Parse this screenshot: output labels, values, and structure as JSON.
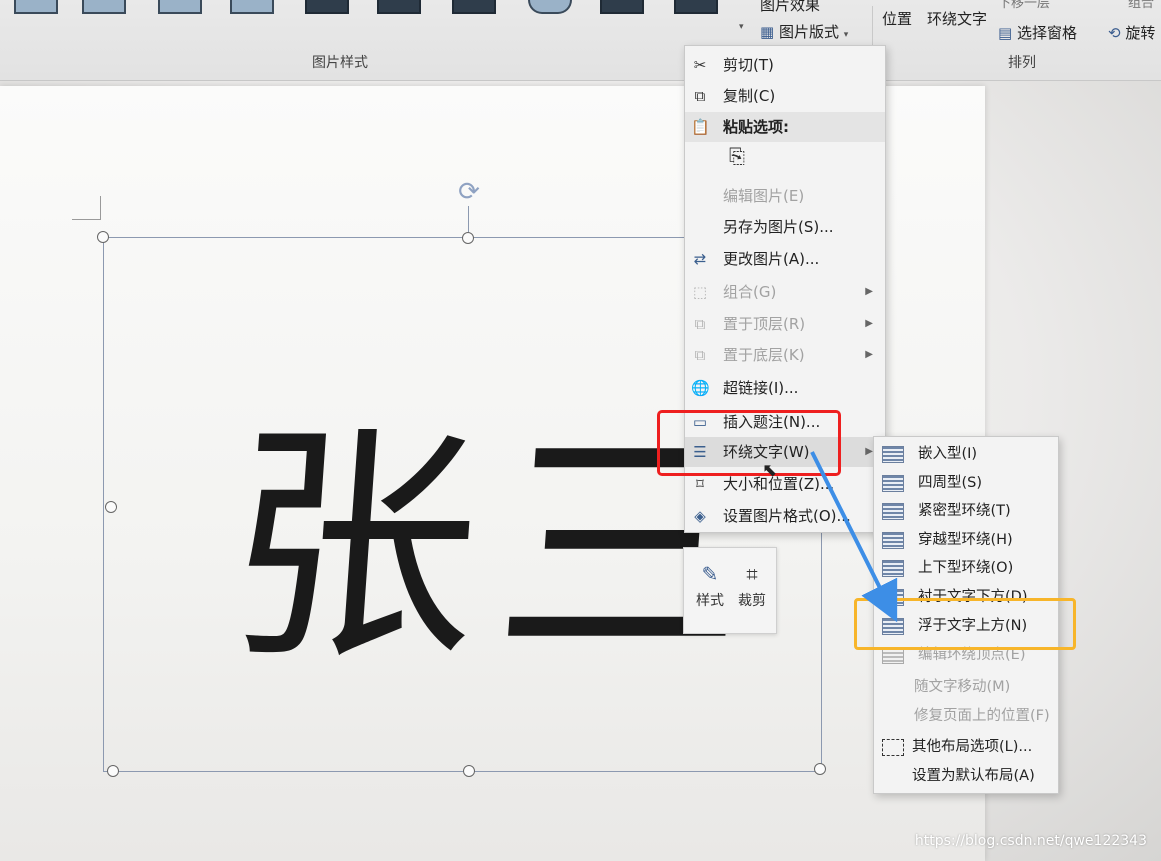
{
  "ribbon": {
    "group_picture_styles": "图片样式",
    "group_arrange": "排列",
    "picture_effects": "图片效果",
    "picture_layout": "图片版式",
    "position": "位置",
    "wrap_text": "环绕文字",
    "send_backward": "下移一层",
    "selection_pane": "选择窗格",
    "rotate": "旋转",
    "group": "组合"
  },
  "canvas": {
    "handwriting": "张三"
  },
  "mini_toolbar": {
    "style_label": "样式",
    "crop_label": "裁剪"
  },
  "context_menu": {
    "items": [
      {
        "label": "剪切(T)",
        "icon": "scissors-icon"
      },
      {
        "label": "复制(C)",
        "icon": "copy-icon"
      },
      {
        "label": "粘贴选项:",
        "icon": "clipboard-icon"
      },
      {
        "label": "编辑图片(E)",
        "icon": ""
      },
      {
        "label": "另存为图片(S)...",
        "icon": ""
      },
      {
        "label": "更改图片(A)...",
        "icon": "change-picture-icon"
      },
      {
        "label": "组合(G)",
        "icon": "group-icon"
      },
      {
        "label": "置于顶层(R)",
        "icon": "bring-front-icon"
      },
      {
        "label": "置于底层(K)",
        "icon": "send-back-icon"
      },
      {
        "label": "超链接(I)...",
        "icon": "hyperlink-icon"
      },
      {
        "label": "插入题注(N)...",
        "icon": "caption-icon"
      },
      {
        "label": "环绕文字(W)",
        "icon": "wrap-text-icon"
      },
      {
        "label": "大小和位置(Z)...",
        "icon": "size-position-icon"
      },
      {
        "label": "设置图片格式(O)...",
        "icon": "format-picture-icon"
      }
    ]
  },
  "wrap_submenu": {
    "items": [
      {
        "label": "嵌入型(I)"
      },
      {
        "label": "四周型(S)"
      },
      {
        "label": "紧密型环绕(T)"
      },
      {
        "label": "穿越型环绕(H)"
      },
      {
        "label": "上下型环绕(O)"
      },
      {
        "label": "衬于文字下方(D)"
      },
      {
        "label": "浮于文字上方(N)"
      },
      {
        "label": "编辑环绕顶点(E)"
      },
      {
        "label": "随文字移动(M)"
      },
      {
        "label": "修复页面上的位置(F)"
      },
      {
        "label": "其他布局选项(L)..."
      },
      {
        "label": "设置为默认布局(A)"
      }
    ]
  },
  "annotations": {
    "red_color": "#ee1f1f",
    "orange_color": "#f7b52a",
    "arrow_color": "#3d8ee6"
  },
  "watermark": "https://blog.csdn.net/qwe122343"
}
